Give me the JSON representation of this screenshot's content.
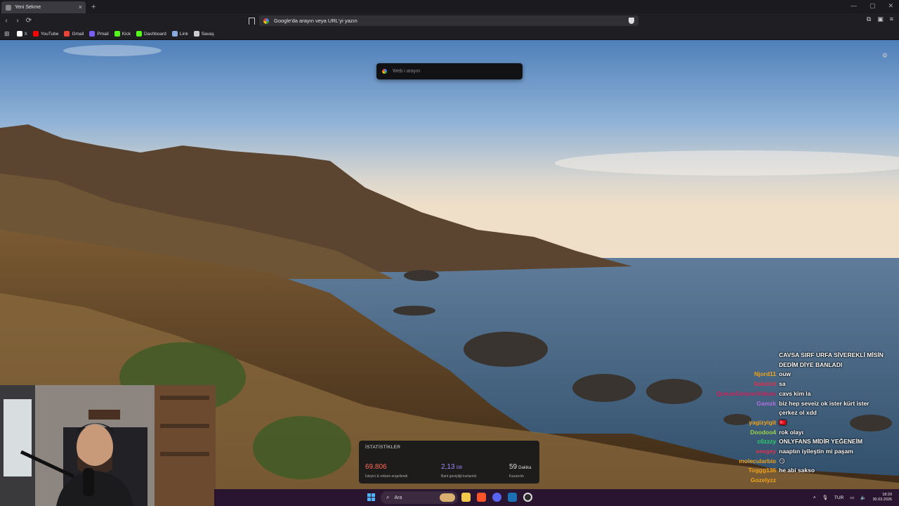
{
  "browser": {
    "tab_title": "Yeni Sekme",
    "url_placeholder": "Google'da arayın veya URL'yi yazın",
    "bookmarks": [
      {
        "label": "X",
        "icon": "x-icon",
        "color": "#ffffff"
      },
      {
        "label": "YouTube",
        "icon": "youtube-icon",
        "color": "#ff0000"
      },
      {
        "label": "Gmail",
        "icon": "gmail-icon",
        "color": "#ea4335"
      },
      {
        "label": "Pmail",
        "icon": "proton-mail-icon",
        "color": "#7b5cf5"
      },
      {
        "label": "Kick",
        "icon": "kick-icon",
        "color": "#53fc18"
      },
      {
        "label": "Dashboard",
        "icon": "kick-icon",
        "color": "#53fc18"
      },
      {
        "label": "Link",
        "icon": "link-icon",
        "color": "#8ad"
      },
      {
        "label": "Savaş",
        "icon": "folder-icon",
        "color": "#cccccc"
      }
    ]
  },
  "newtab": {
    "search_placeholder": "Web i arayın"
  },
  "stats": {
    "title": "İSTATİSTİKLER",
    "items": [
      {
        "value": "69.806",
        "unit": "",
        "desc": "İzleyici & reklam engellendi",
        "color": "#ff6b5a"
      },
      {
        "value": "2,13",
        "unit": "GB",
        "desc": "Bant genişliği kurtarıldı",
        "color": "#9a8cff"
      },
      {
        "value": "59",
        "unit": "Dakika",
        "desc": "Kazanıldı",
        "color": "#ffffff"
      }
    ]
  },
  "chat": [
    {
      "user": "",
      "color": "#2a6bd6",
      "text": "CAVSA SIRF URFA SİVEREKLİ MİSİN"
    },
    {
      "user": "",
      "color": "#ffffff",
      "text": "DEDİM DİYE BANLADI"
    },
    {
      "user": "Njord11",
      "color": "#f0a21a",
      "text": "ouw"
    },
    {
      "user": "Xakelcd",
      "color": "#e03050",
      "text": "sa"
    },
    {
      "user": "QonunGotunoVidans",
      "color": "#d01f5a",
      "text": "cavs kim la"
    },
    {
      "user": "Gamzk",
      "color": "#b070e0",
      "text": "biz hep seveiz ok ister kürt ister"
    },
    {
      "user": "",
      "color": "#ffffff",
      "text": "çerkez ol xdd"
    },
    {
      "user": "yagizyigit",
      "color": "#f0a21a",
      "text": "🇹🇷"
    },
    {
      "user": "Doodoo4",
      "color": "#9ad24a",
      "text": "rok olayı"
    },
    {
      "user": "c0zzzy",
      "color": "#2ecf6a",
      "text": "ONLYFANS MİDİR YEĞENEİM"
    },
    {
      "user": "sevgey",
      "color": "#e03050",
      "text": "naaptın iyileştin mi paşam"
    },
    {
      "user": "molecularbio",
      "color": "#f0a21a",
      "text": "😏"
    },
    {
      "user": "Toggg136",
      "color": "#f0a21a",
      "text": "he abi sakso"
    },
    {
      "user": "Gozelyzz",
      "color": "#f0a21a",
      "text": ""
    }
  ],
  "taskbar": {
    "search_label": "Ara",
    "language": "TUR",
    "time": "18:20",
    "date": "30.03.2026"
  }
}
